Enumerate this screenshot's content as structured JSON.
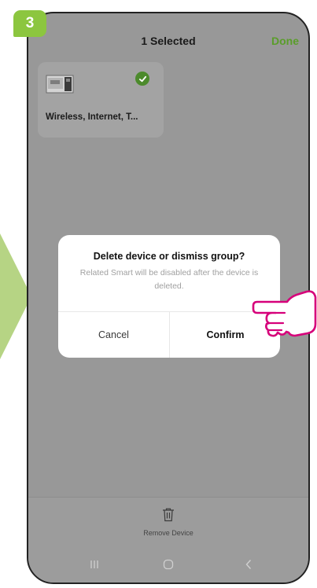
{
  "step": {
    "number": "3"
  },
  "header": {
    "title": "1 Selected",
    "done_label": "Done"
  },
  "device": {
    "name": "Wireless, Internet, T...",
    "selected": true
  },
  "dialog": {
    "title": "Delete device or dismiss group?",
    "message": "Related Smart will be disabled after the device is deleted.",
    "cancel_label": "Cancel",
    "confirm_label": "Confirm"
  },
  "bottom_bar": {
    "remove_label": "Remove Device",
    "icon": "trash-icon"
  },
  "nav": {
    "items": [
      "recent-apps-icon",
      "home-icon",
      "back-icon"
    ]
  },
  "colors": {
    "accent_green": "#8cc63f",
    "done_green": "#5a9d2a",
    "hand_magenta": "#d6007a",
    "overlay": "#989898"
  }
}
